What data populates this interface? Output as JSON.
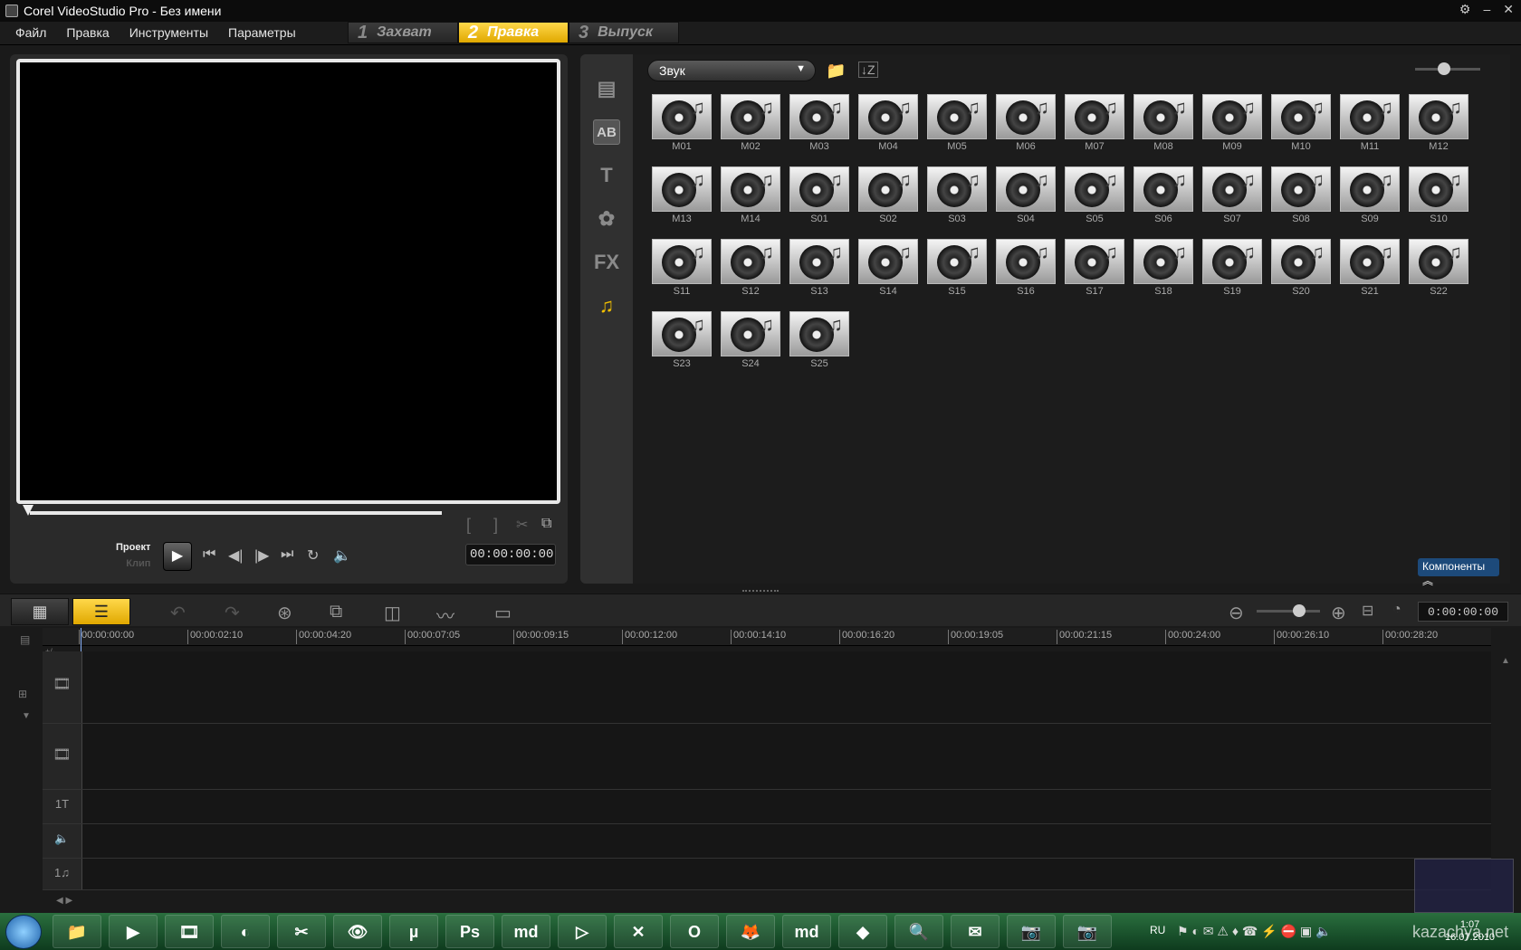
{
  "window": {
    "title": "Corel VideoStudio Pro - Без имени",
    "controls": [
      "⚙",
      "–",
      "✕"
    ]
  },
  "menu": [
    "Файл",
    "Правка",
    "Инструменты",
    "Параметры"
  ],
  "steps": [
    {
      "num": "1",
      "label": "Захват",
      "active": false
    },
    {
      "num": "2",
      "label": "Правка",
      "active": true
    },
    {
      "num": "3",
      "label": "Выпуск",
      "active": false
    }
  ],
  "preview": {
    "project_label": "Проект",
    "clip_label": "Клип",
    "timecode": "00:00:00:00",
    "trim_start": "[",
    "trim_end": "]"
  },
  "library": {
    "category": "Звук",
    "side_icons": [
      "media-icon",
      "transition-icon",
      "title-icon",
      "graphics-icon",
      "fx-icon",
      "audio-icon"
    ],
    "side_glyphs": [
      "▤",
      "AB",
      "T",
      "✿",
      "FX",
      "♫"
    ],
    "items": [
      "M01",
      "M02",
      "M03",
      "M04",
      "M05",
      "M06",
      "M07",
      "M08",
      "M09",
      "M10",
      "M11",
      "M12",
      "M13",
      "M14",
      "S01",
      "S02",
      "S03",
      "S04",
      "S05",
      "S06",
      "S07",
      "S08",
      "S09",
      "S10",
      "S11",
      "S12",
      "S13",
      "S14",
      "S15",
      "S16",
      "S17",
      "S18",
      "S19",
      "S20",
      "S21",
      "S22",
      "S23",
      "S24",
      "S25"
    ],
    "components_label": "Компоненты"
  },
  "timeline": {
    "timecode": "0:00:00:00",
    "ruler": [
      "00:00:00:00",
      "00:00:02:10",
      "00:00:04:20",
      "00:00:07:05",
      "00:00:09:15",
      "00:00:12:00",
      "00:00:14:10",
      "00:00:16:20",
      "00:00:19:05",
      "00:00:21:15",
      "00:00:24:00",
      "00:00:26:10",
      "00:00:28:20"
    ],
    "track_icons": [
      "🎞",
      "🎞",
      "1T",
      "🔈",
      "1♫"
    ]
  },
  "taskbar": {
    "lang": "RU",
    "time": "1:07",
    "date": "16.07.2010",
    "apps": [
      "📁",
      "▶",
      "🎞",
      "◐",
      "✂",
      "👁",
      "µ",
      "Ps",
      "md",
      "▷",
      "✕",
      "O",
      "🦊",
      "md",
      "◆",
      "🔍",
      "✉",
      "📷",
      "📷"
    ]
  },
  "watermark": "kazachya.net",
  "colors": {
    "accent": "#f2c000",
    "background": "#1a1a1a"
  }
}
